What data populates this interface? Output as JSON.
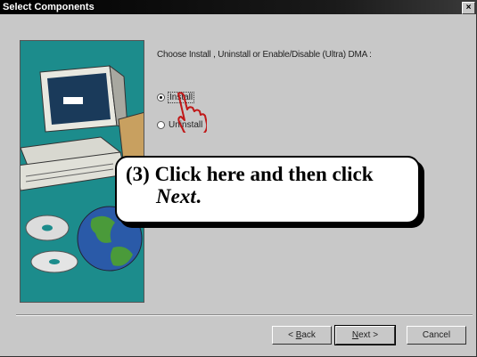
{
  "window": {
    "title": "Select Components",
    "close_glyph": "×"
  },
  "content": {
    "prompt": "Choose Install , Uninstall or Enable/Disable (Ultra) DMA :",
    "options": [
      {
        "label": "Install",
        "checked": true
      },
      {
        "label": "Uninstall",
        "checked": false
      }
    ]
  },
  "callout": {
    "line1": "(3) Click here and then click",
    "line2_word": "Next",
    "line2_end": "."
  },
  "buttons": {
    "back": {
      "mnemonic": "B",
      "rest": "ack",
      "prefix": "< "
    },
    "next": {
      "mnemonic": "N",
      "rest": "ext",
      "suffix": " >"
    },
    "cancel": "Cancel"
  },
  "icons": [
    "computer-illustration",
    "cd-discs-illustration",
    "globe-illustration",
    "hand-pointer-icon"
  ],
  "colors": {
    "art_background": "#1c8c8c",
    "dialog_face": "#c8c8c8"
  }
}
